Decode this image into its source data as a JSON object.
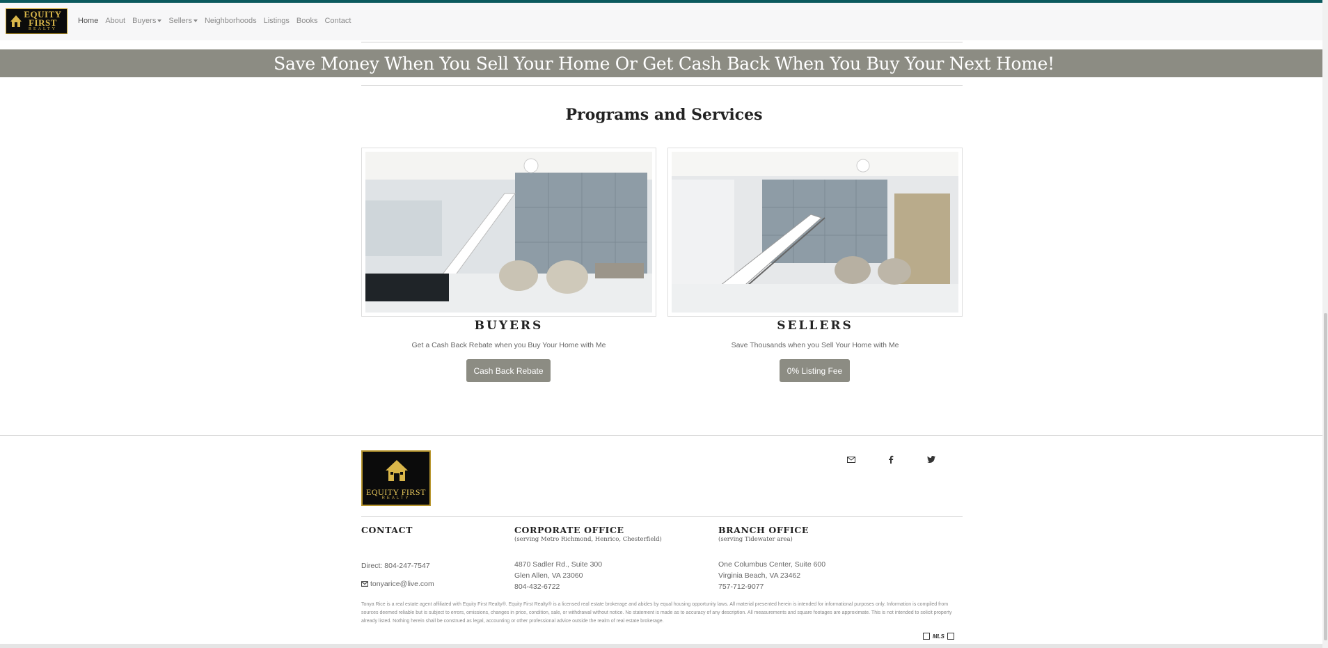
{
  "navbar": {
    "logo_text": "EQUITY FIRST",
    "logo_sub": "REALTY",
    "items": [
      {
        "label": "Home"
      },
      {
        "label": "About"
      },
      {
        "label": "Buyers"
      },
      {
        "label": "Sellers"
      },
      {
        "label": "Neighborhoods"
      },
      {
        "label": "Listings"
      },
      {
        "label": "Books"
      },
      {
        "label": "Contact"
      }
    ]
  },
  "banner": {
    "headline": "Save Money When You Sell Your Home Or Get Cash Back When You Buy Your Next Home!"
  },
  "programs": {
    "title": "Programs and Services",
    "cards": [
      {
        "title": "BUYERS",
        "subtitle": "Get a Cash Back Rebate when you Buy Your Home with Me",
        "button": "Cash Back Rebate"
      },
      {
        "title": "SELLERS",
        "subtitle": "Save Thousands when you Sell Your Home with Me",
        "button": "0% Listing Fee"
      }
    ]
  },
  "footer": {
    "logo_text": "EQUITY FIRST",
    "logo_sub": "REALTY",
    "social": [
      {
        "icon": "envelope-icon"
      },
      {
        "icon": "facebook-icon"
      },
      {
        "icon": "twitter-icon"
      }
    ],
    "contact": {
      "heading": "CONTACT",
      "direct_label": "Direct:",
      "direct_phone": "804-247-7547",
      "email": "tonyarice@live.com"
    },
    "corporate": {
      "heading": "CORPORATE OFFICE",
      "sub": "(serving Metro Richmond, Henrico, Chesterfield)",
      "address1": "4870 Sadler Rd., Suite 300",
      "address2": "Glen Allen, VA 23060",
      "phone": "804-432-6722"
    },
    "branch": {
      "heading": "BRANCH OFFICE",
      "sub": "(serving Tidewater area)",
      "address1": "One Columbus Center, Suite 600",
      "address2": "Virginia Beach, VA 23462",
      "phone": "757-712-9077"
    },
    "disclaimer": "Tonya Rice is a real estate agent affiliated with Equity First Realty®. Equity First Realty® is a licensed real estate brokerage and abides by equal housing opportunity laws. All material presented herein is intended for informational purposes only. Information is compiled from sources deemed reliable but is subject to errors, omissions, changes in price, condition, sale, or withdrawal without notice. No statement is made as to accuracy of any description. All measurements and square footages are approximate. This is not intended to solicit property already listed. Nothing herein shall be construed as legal, accounting or other professional advice outside the realm of real estate brokerage.",
    "mls_label": "MLS"
  }
}
